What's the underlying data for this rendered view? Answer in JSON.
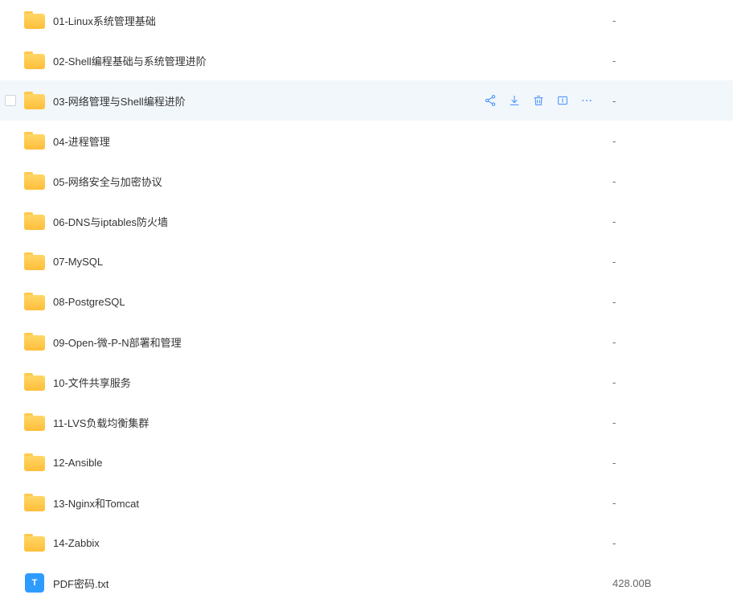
{
  "hoveredIndex": 2,
  "txtIconLabel": "T",
  "files": [
    {
      "name": "01-Linux系统管理基础",
      "type": "folder",
      "size": "-"
    },
    {
      "name": "02-Shell编程基础与系统管理进阶",
      "type": "folder",
      "size": "-"
    },
    {
      "name": "03-网络管理与Shell编程进阶",
      "type": "folder",
      "size": "-"
    },
    {
      "name": "04-进程管理",
      "type": "folder",
      "size": "-"
    },
    {
      "name": "05-网络安全与加密协议",
      "type": "folder",
      "size": "-"
    },
    {
      "name": "06-DNS与iptables防火墙",
      "type": "folder",
      "size": "-"
    },
    {
      "name": "07-MySQL",
      "type": "folder",
      "size": "-"
    },
    {
      "name": "08-PostgreSQL",
      "type": "folder",
      "size": "-"
    },
    {
      "name": "09-Open-微-P-N部署和管理",
      "type": "folder",
      "size": "-"
    },
    {
      "name": "10-文件共享服务",
      "type": "folder",
      "size": "-"
    },
    {
      "name": "11-LVS负载均衡集群",
      "type": "folder",
      "size": "-"
    },
    {
      "name": "12-Ansible",
      "type": "folder",
      "size": "-"
    },
    {
      "name": "13-Nginx和Tomcat",
      "type": "folder",
      "size": "-"
    },
    {
      "name": "14-Zabbix",
      "type": "folder",
      "size": "-"
    },
    {
      "name": "PDF密码.txt",
      "type": "txt",
      "size": "428.00B"
    }
  ]
}
